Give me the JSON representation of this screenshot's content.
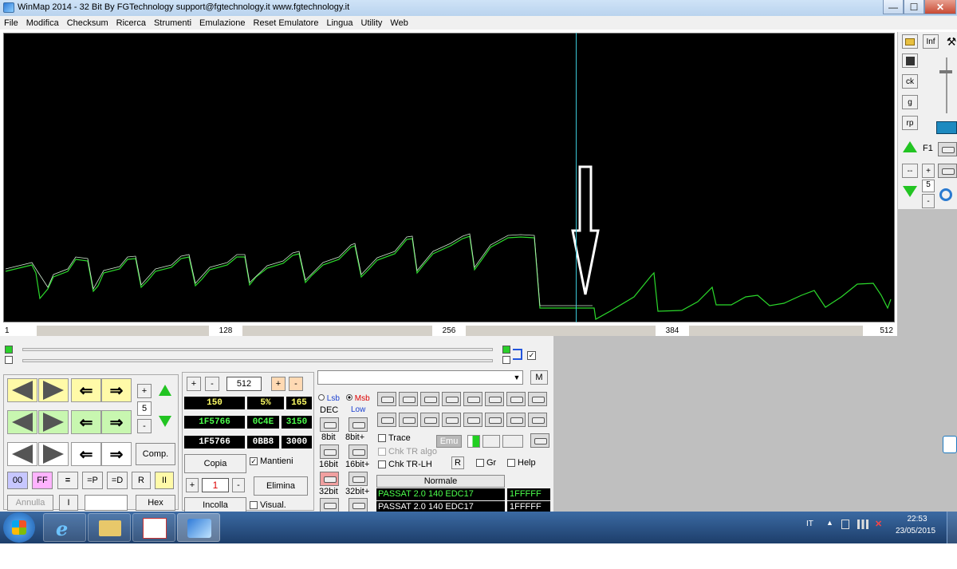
{
  "window": {
    "title": "WinMap 2014 - 32 Bit  By FGTechnology     support@fgtechnology.it   www.fgtechnology.it",
    "min": "—",
    "max": "☐",
    "close": "✕"
  },
  "menu": [
    "File",
    "Modifica",
    "Checksum",
    "Ricerca",
    "Strumenti",
    "Emulazione",
    "Reset Emulatore",
    "Lingua",
    "Utility",
    "Web"
  ],
  "axis": {
    "ticks": [
      "1",
      "128",
      "256",
      "384",
      "512"
    ]
  },
  "right_panel": {
    "inf": "Inf",
    "ck": "ck",
    "g": "g",
    "rp": "rp",
    "f1": "F1",
    "dash": "--",
    "plus": "+",
    "minus": "-",
    "value": "5"
  },
  "controls": {
    "step_value": "5",
    "plus": "+",
    "minus": "-",
    "comp": "Comp.",
    "btn_00": "00",
    "btn_ff": "FF",
    "btn_eq": "=",
    "btn_p": "=P",
    "btn_d": "=D",
    "btn_r": "R",
    "btn_pause": "II",
    "annulla": "Annulla",
    "bar": "I",
    "hex": "Hex",
    "width_value": "512",
    "row1": [
      "150",
      "5%",
      "165"
    ],
    "row2": [
      "1F5766",
      "0C4E",
      "3150"
    ],
    "row3": [
      "1F5766",
      "0BB8",
      "3000"
    ],
    "copia": "Copia",
    "mantieni": "Mantieni",
    "elimina": "Elimina",
    "incolla": "Incolla",
    "visual": "Visual.",
    "offset_value": "1",
    "m_btn": "M",
    "lsb": "Lsb",
    "msb": "Msb",
    "dec": "DEC",
    "low": "Low",
    "bits": [
      "8bit",
      "8bit+",
      "16bit",
      "16bit+",
      "32bit",
      "32bit+"
    ],
    "trace": "Trace",
    "emu": "Emu",
    "chk_tr_algo": "Chk TR algo",
    "chk_tr_lh": "Chk TR-LH",
    "r": "R",
    "gr": "Gr",
    "help": "Help",
    "normale": "Normale",
    "files": [
      {
        "name": "PASSAT 2.0 140 EDC17",
        "addr": "1FFFFF"
      },
      {
        "name": "PASSAT 2.0 140 EDC17",
        "addr": "1FFFFF"
      }
    ]
  },
  "tray": {
    "lang": "IT",
    "time": "22:53",
    "date": "23/05/2015"
  },
  "colors": {
    "graph_line": "#2bd92b",
    "cursor": "#3cc8d8",
    "background": "#000000"
  }
}
